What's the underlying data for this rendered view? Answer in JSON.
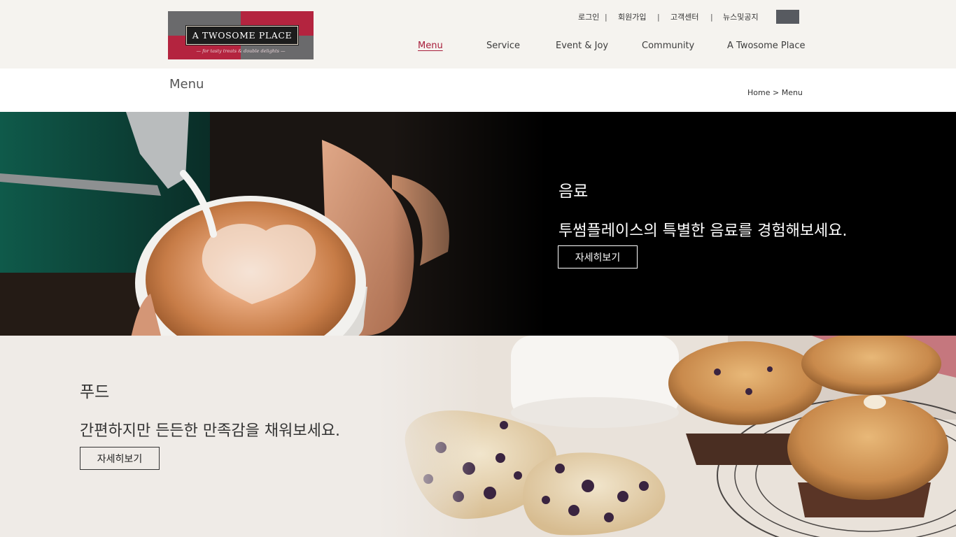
{
  "header": {
    "logo": {
      "text": "A TWOSOME PLACE",
      "tagline": "— for tasty treats & double delights —",
      "colors": {
        "grey": "#6a6a6c",
        "red": "#b4243f"
      }
    },
    "utility_links": [
      {
        "label": "로그인"
      },
      {
        "label": "회원가입"
      },
      {
        "label": "고객센터"
      },
      {
        "label": "뉴스및공지"
      }
    ],
    "separator": "|",
    "nav": [
      {
        "label": "Menu",
        "active": true
      },
      {
        "label": "Service",
        "active": false
      },
      {
        "label": "Event & Joy",
        "active": false
      },
      {
        "label": "Community",
        "active": false
      },
      {
        "label": "A Twosome Place",
        "active": false
      }
    ],
    "accent_color": "#a71d3a"
  },
  "page": {
    "title": "Menu",
    "breadcrumb": {
      "home": "Home",
      "separator": ">",
      "current": "Menu"
    }
  },
  "banners": {
    "drink": {
      "title": "음료",
      "description": "투썸플레이스의 특별한 음료를 경험해보세요.",
      "button": "자세히보기",
      "image_icon": "latte-art-photo"
    },
    "food": {
      "title": "푸드",
      "description": "간편하지만 든든한 만족감을 채워보세요.",
      "button": "자세히보기",
      "image_icon": "blueberry-muffin-photo"
    }
  }
}
